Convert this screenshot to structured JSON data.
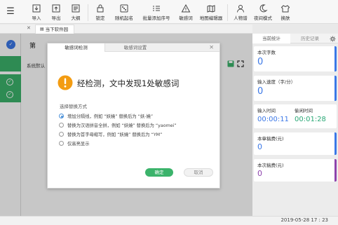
{
  "toolbar": {
    "items": [
      {
        "label": "导入",
        "icon": "import-icon"
      },
      {
        "label": "导出",
        "icon": "export-icon"
      },
      {
        "label": "大纲",
        "icon": "outline-icon"
      },
      {
        "label": "锁定",
        "icon": "lock-icon"
      },
      {
        "label": "随机起名",
        "icon": "random-name-icon"
      },
      {
        "label": "批量添加序号",
        "icon": "batch-number-icon"
      },
      {
        "label": "敏感词",
        "icon": "sensitive-word-icon"
      },
      {
        "label": "地图编辑器",
        "icon": "map-editor-icon"
      },
      {
        "label": "人物谱",
        "icon": "character-icon"
      },
      {
        "label": "夜间模式",
        "icon": "night-mode-icon"
      },
      {
        "label": "换肤",
        "icon": "skin-icon"
      }
    ]
  },
  "tabbar": {
    "close": "✕",
    "doc_tab": "当下软件园"
  },
  "sidebar": {
    "badge": "✓"
  },
  "document": {
    "title": "第",
    "subtitle": "系统默认"
  },
  "dialog": {
    "tab_active": "敏感词检测",
    "tab_inactive": "敏感词设置",
    "close": "✕",
    "message": "经检测，文中发现1处敏感词",
    "choose_label": "选择替换方式",
    "options": [
      "增加分隔线，例如 “妖嬈” 替换后为 “妖-嬈”",
      "替换为汉语拼音全拼，例如 “妖嬈” 替换后为 “yaomei”",
      "替换为首字母缩写，例如 “妖嬈” 替换后为 “YM”",
      "仅高亮显示"
    ],
    "selected_option": 0,
    "ok_label": "确定",
    "cancel_label": "取消"
  },
  "right_panel": {
    "tab_current": "当前统计",
    "tab_history": "历史记录",
    "word_count_label": "本次字数",
    "word_count_value": "0",
    "speed_label": "输入速度（字/分）",
    "speed_value": "0",
    "input_time_label": "输入时间",
    "input_time_value": "00:00:11",
    "idle_time_label": "偷闲时间",
    "idle_time_value": "00:01:28",
    "session_income_label": "本章稿费(元)",
    "session_income_value": "0",
    "total_income_label": "本次稿费(元)",
    "total_income_value": "0"
  },
  "status": {
    "datetime": "2019-05-28 17 : 23"
  },
  "colors": {
    "accent_green": "#3bb36b",
    "accent_blue": "#3b78e7",
    "warning_orange": "#f39c12",
    "idle_green": "#2aa876",
    "income_purple": "#8e44ad"
  }
}
